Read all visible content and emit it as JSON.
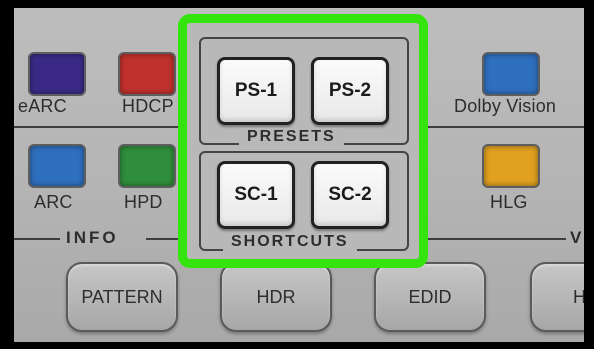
{
  "indicators": {
    "earc": {
      "label": "eARC",
      "color": "#3a2a86"
    },
    "hdcp": {
      "label": "HDCP",
      "color": "#c0312d"
    },
    "dolby_vision": {
      "label": "Dolby Vision",
      "color": "#2f6fbf"
    },
    "arc": {
      "label": "ARC",
      "color": "#2f6fbf"
    },
    "hpd": {
      "label": "HPD",
      "color": "#2f8e3c"
    },
    "hlg": {
      "label": "HLG",
      "color": "#e0a020"
    }
  },
  "sections": {
    "info": "INFO",
    "right_partial": "V"
  },
  "presets": {
    "group_label": "PRESETS",
    "ps1": "PS-1",
    "ps2": "PS-2"
  },
  "shortcuts": {
    "group_label": "SHORTCUTS",
    "sc1": "SC-1",
    "sc2": "SC-2"
  },
  "bottom_buttons": {
    "pattern": "PATTERN",
    "hdr": "HDR",
    "edid": "EDID",
    "partial": "HD"
  },
  "highlight_color": "#34e40f"
}
